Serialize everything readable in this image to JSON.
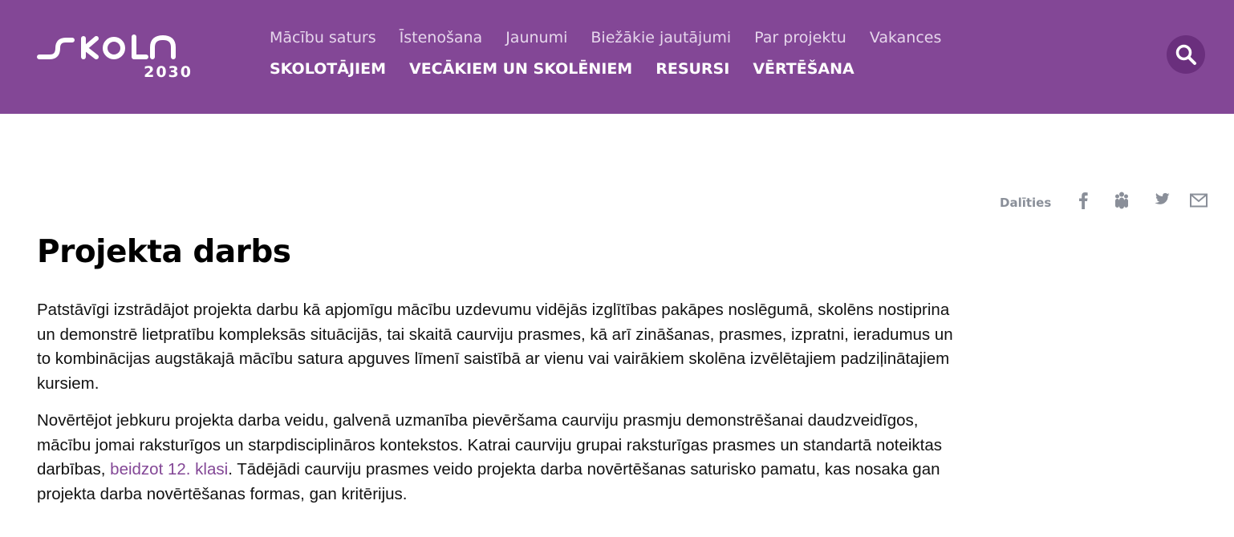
{
  "logo": {
    "word": "SKOLA",
    "year": "2030"
  },
  "nav": {
    "top": [
      "Mācību saturs",
      "Īstenošana",
      "Jaunumi",
      "Biežākie jautājumi",
      "Par projektu",
      "Vakances"
    ],
    "bottom": [
      "SKOLOTĀJIEM",
      "VECĀKIEM UN SKOLĒNIEM",
      "RESURSI",
      "VĒRTĒŠANA"
    ]
  },
  "icons": {
    "search": "search-icon",
    "share": [
      "facebook-icon",
      "draugiem-icon",
      "twitter-icon",
      "email-icon"
    ]
  },
  "share": {
    "label": "Dalīties"
  },
  "page": {
    "title": "Projekta darbs",
    "paragraph1": "Patstāvīgi izstrādājot projekta darbu kā apjomīgu mācību uzdevumu vidējās izglītības pakāpes noslēgumā, skolēns nostiprina un demonstrē lietpratību kompleksās situācijās, tai skaitā caurviju prasmes, kā arī zināšanas, prasmes, izpratni, ieradumus un to kombinācijas augstākajā mācību satura apguves līmenī saistībā ar vienu vai vairākiem skolēna izvēlētajiem padziļinātajiem kursiem.",
    "paragraph2_before": "Novērtējot jebkuru projekta darba veidu, galvenā uzmanība pievēršama caurviju prasmju demonstrēšanai daudzveidīgos, mācību jomai raksturīgos un starpdisciplināros kontekstos. Katrai caurviju grupai raksturīgas prasmes un standartā noteiktas darbības, ",
    "paragraph2_link": "beidzot 12. klasi",
    "paragraph2_after": ". Tādējādi caurviju prasmes veido projekta darba novērtēšanas saturisko pamatu, kas nosaka gan projekta darba novērtēšanas formas, gan kritērijus."
  },
  "colors": {
    "header_bg": "#834796",
    "search_bg": "#6a2f7d",
    "link": "#834796",
    "share_gray": "#8a8f99"
  }
}
